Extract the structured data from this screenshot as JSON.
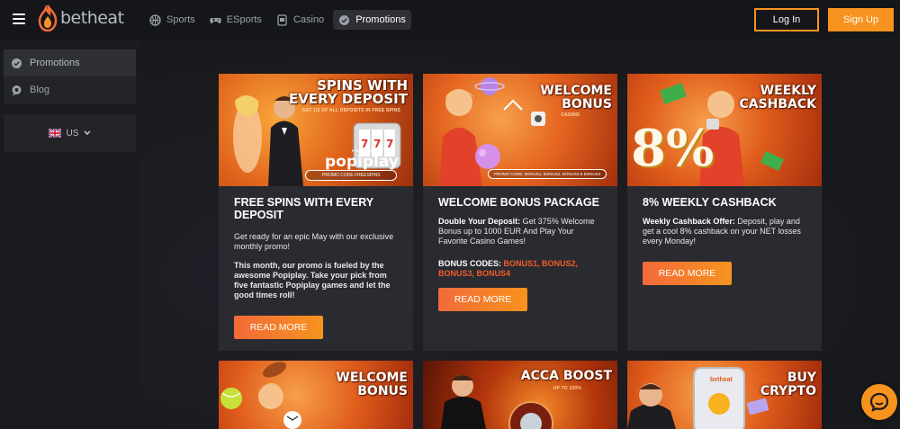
{
  "brand": {
    "name": "betheat"
  },
  "nav": [
    {
      "label": "Sports",
      "icon": "basketball-icon"
    },
    {
      "label": "ESports",
      "icon": "gamepad-icon"
    },
    {
      "label": "Casino",
      "icon": "slot-card-icon"
    },
    {
      "label": "Promotions",
      "icon": "badge-check-icon",
      "active": true
    }
  ],
  "auth": {
    "login": "Log In",
    "signup": "Sign Up"
  },
  "sidebar": {
    "items": [
      {
        "label": "Promotions",
        "icon": "badge-check-icon",
        "active": true
      },
      {
        "label": "Blog",
        "icon": "chat-bubble-icon"
      }
    ],
    "language": "US"
  },
  "cards": [
    {
      "banner": {
        "title_line1": "SPINS WITH",
        "title_line2": "EVERY DEPOSIT",
        "sub": "GET 1/2 OF ALL DEPOSITS IN FREE SPINS",
        "powered": "POWERED BY",
        "brand": "popiplay",
        "code": "PROMO CODE FREESPINS"
      },
      "title": "FREE SPINS WITH EVERY DEPOSIT",
      "text1": "Get ready for an epic May with our exclusive monthly promo!",
      "text2": "This month, our promo is fueled by the awesome Popiplay. Take your pick from five fantastic Popiplay games and let the good times roll!",
      "button": "READ MORE"
    },
    {
      "banner": {
        "title_line1": "WELCOME",
        "title_line2": "BONUS",
        "sub": "CASINO",
        "code": "PROMO CODE: BONUS1, BONUS2, BONUS3 & BONUS4"
      },
      "title": "WELCOME BONUS PACKAGE",
      "lead": "Double Your Deposit:",
      "text1": " Get 375% Welcome Bonus up to 1000 EUR And Play Your Favorite Casino Games!",
      "codes_label": "BONUS CODES: ",
      "codes_value": "BONUS1, BONUS2, BONUS3, BONUS4",
      "button": "READ MORE"
    },
    {
      "banner": {
        "title_line1": "WEEKLY",
        "title_line2": "CASHBACK",
        "big": "8%"
      },
      "title": "8% WEEKLY CASHBACK",
      "lead": "Weekly Cashback Offer:",
      "text1": " Deposit, play and get a cool 8% cashback on your NET losses every Monday!",
      "button": "READ MORE"
    },
    {
      "banner": {
        "title_line1": "WELCOME",
        "title_line2": "BONUS"
      }
    },
    {
      "banner": {
        "title_line1": "ACCA BOOST",
        "sub": "UP TO 100%"
      }
    },
    {
      "banner": {
        "title_line1": "BUY",
        "title_line2": "CRYPTO",
        "brand": "betheat"
      }
    }
  ],
  "colors": {
    "accent": "#f7931e",
    "highlight": "#f25c2a",
    "card": "#2a2b30",
    "bg": "#1a1b1e"
  }
}
